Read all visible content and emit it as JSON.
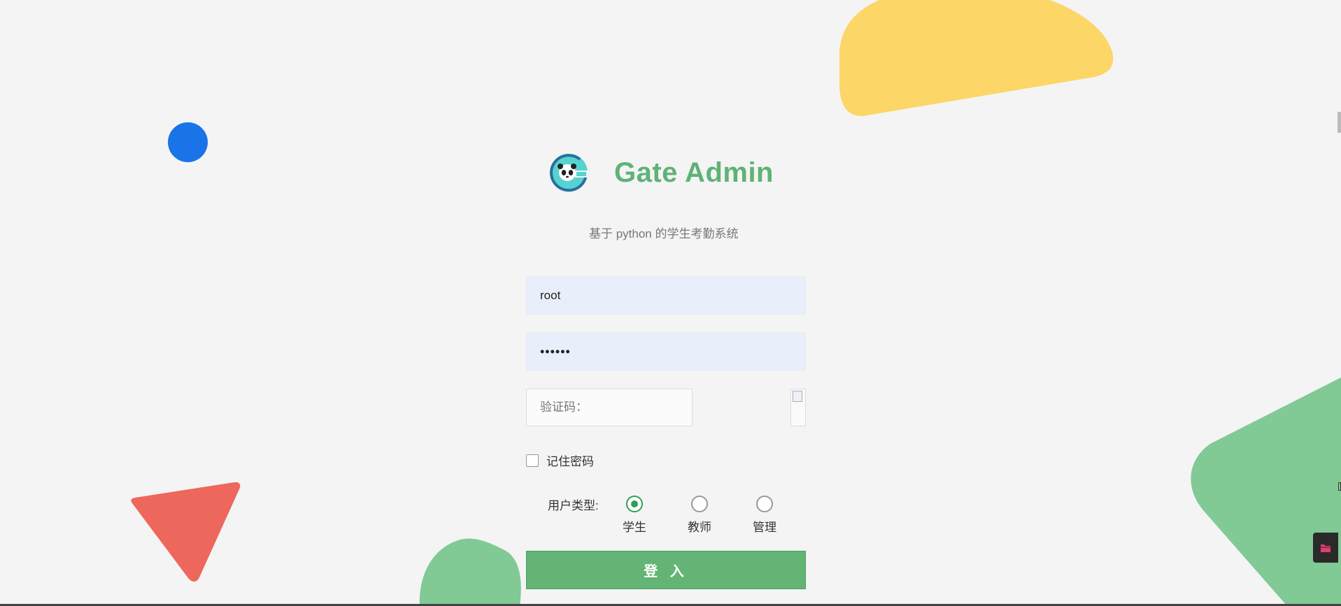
{
  "app": {
    "title": "Gate Admin",
    "subtitle": "基于 python 的学生考勤系统"
  },
  "login": {
    "username_value": "root",
    "password_value": "••••••",
    "captcha_placeholder": "验证码：",
    "remember_label": "记住密码",
    "user_type_label": "用户类型:",
    "user_types": [
      {
        "label": "学生",
        "selected": true
      },
      {
        "label": "教师",
        "selected": false
      },
      {
        "label": "管理",
        "selected": false
      }
    ],
    "submit_label": "登 入"
  },
  "colors": {
    "brand_green": "#5fb276",
    "button_green": "#63b475",
    "radio_green": "#2e9e5b",
    "deco_blue": "#1b73e8",
    "deco_yellow": "#fcd666",
    "deco_red": "#ee675c",
    "deco_green": "#81c995"
  },
  "icons": {
    "logo": "panda-g-logo",
    "side_tab": "folder-icon",
    "captcha": "broken-image-icon"
  }
}
